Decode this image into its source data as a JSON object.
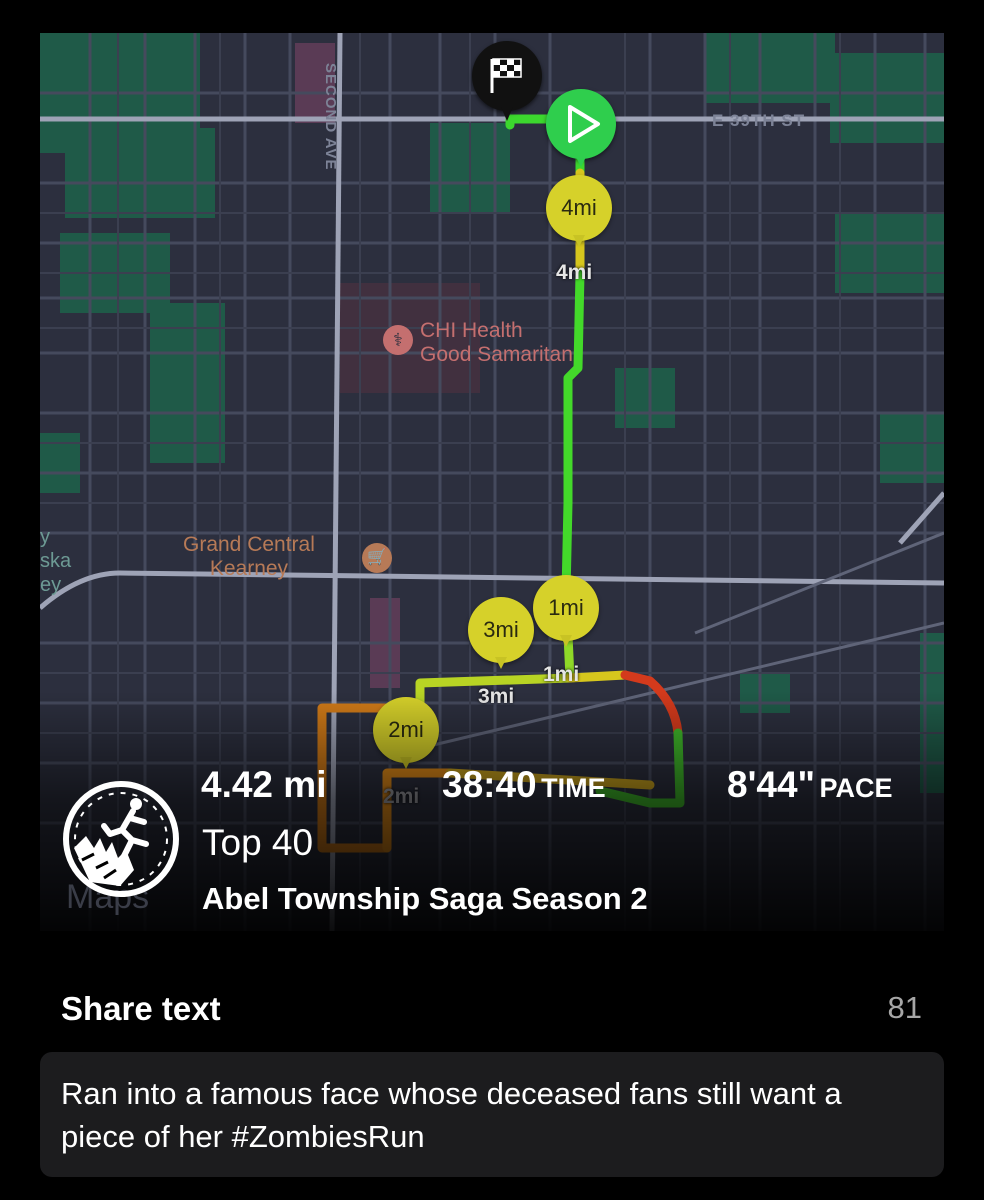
{
  "map": {
    "street_labels": {
      "second_ave": "SECOND AVE",
      "e_39th_st": "E 39TH ST"
    },
    "pois": {
      "hospital_line1": "CHI Health",
      "hospital_line2": "Good Samaritan",
      "shop_line1": "Grand Central",
      "shop_line2": "Kearney",
      "partial_left": "y\nska\ney"
    },
    "watermark": "Maps",
    "icons": {
      "finish": "checkered-flag-icon",
      "start": "play-triangle-icon",
      "hospital": "stethoscope-icon",
      "shop": "shopping-cart-icon"
    },
    "mile_markers": [
      {
        "bubble": "4mi",
        "tag": "4mi"
      },
      {
        "bubble": "1mi",
        "tag": "1mi"
      },
      {
        "bubble": "3mi",
        "tag": "3mi"
      },
      {
        "bubble": "2mi",
        "tag": "2mi"
      }
    ],
    "route_colors": [
      "#3cd72e",
      "#8fd928",
      "#d6c61d",
      "#e08a18",
      "#d43a1c"
    ]
  },
  "run": {
    "distance": "4.42 mi",
    "time_value": "38:40",
    "time_unit": "TIME",
    "pace_value": "8'44\"",
    "pace_unit": "PACE",
    "rank": "Top 40",
    "mission": "Abel Township Saga Season 2",
    "logo_icon": "zombies-run-runner-icon"
  },
  "share": {
    "title": "Share text",
    "char_count": "81",
    "text": "Ran into a famous face whose deceased fans still want a piece of her  #ZombiesRun"
  },
  "colors": {
    "background": "#000000",
    "panel": "#1c1c1e",
    "marker": "#d6d12a",
    "start": "#2fce4d"
  }
}
